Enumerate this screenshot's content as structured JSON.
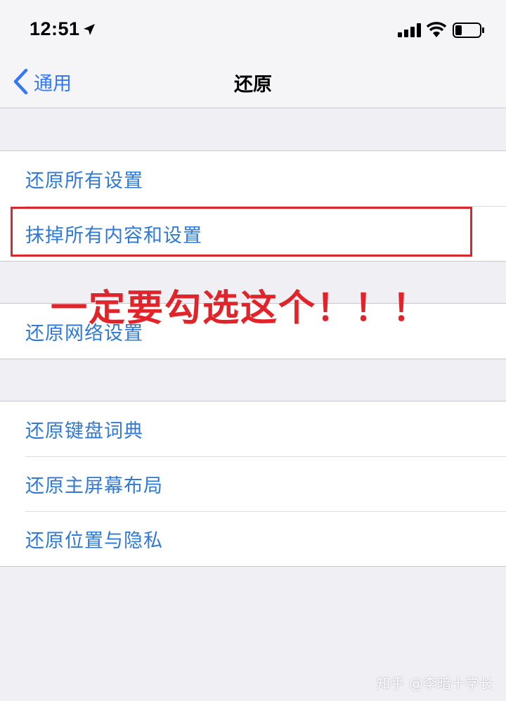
{
  "status_bar": {
    "time": "12:51",
    "icons": [
      "location-arrow-icon",
      "cellular-signal-icon",
      "wifi-icon",
      "battery-icon"
    ]
  },
  "nav": {
    "back_label": "通用",
    "title": "还原"
  },
  "groups": [
    {
      "items": [
        {
          "label": "还原所有设置"
        },
        {
          "label": "抹掉所有内容和设置"
        }
      ]
    },
    {
      "items": [
        {
          "label": "还原网络设置"
        }
      ]
    },
    {
      "items": [
        {
          "label": "还原键盘词典"
        },
        {
          "label": "还原主屏幕布局"
        },
        {
          "label": "还原位置与隐私"
        }
      ]
    }
  ],
  "annotation": {
    "text": "一定要勾选这个！！！",
    "color": "#e2232a"
  },
  "watermark": "知乎 @李暗十学长",
  "colors": {
    "accent": "#3478f6",
    "row_text": "#2f7ad6",
    "background": "#efeff4",
    "highlight": "#d9272e"
  }
}
